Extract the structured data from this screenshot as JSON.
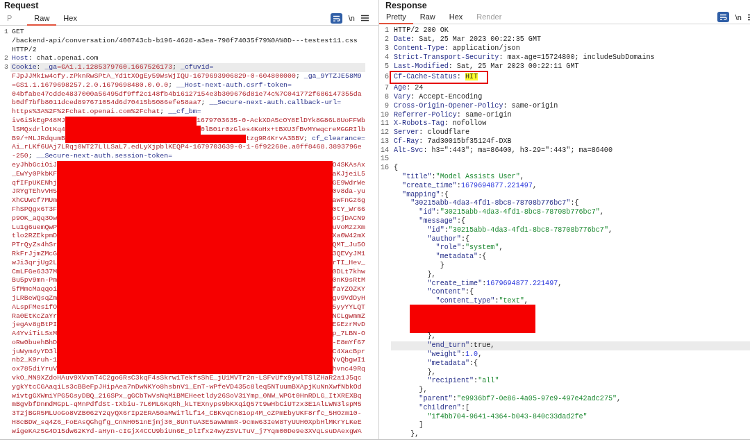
{
  "request": {
    "title": "Request",
    "newline_label": "\\n",
    "tabs": [
      {
        "label": "P",
        "selected": false,
        "disabled": true
      },
      {
        "label": "Raw",
        "selected": true,
        "disabled": false
      },
      {
        "label": "Hex",
        "selected": false,
        "disabled": false
      }
    ],
    "lines": [
      {
        "number": "1",
        "highlighted": false,
        "redacted": false,
        "segments": [
          {
            "kind": "plain",
            "text": "GET"
          }
        ]
      },
      {
        "highlighted": false,
        "redacted": false,
        "segments": [
          {
            "kind": "plain",
            "text": "/backend-api/conversation/400743cb-b196-4628-a3ea-798f74035f79%0A%0D---testest11.css"
          }
        ]
      },
      {
        "highlighted": false,
        "redacted": false,
        "segments": [
          {
            "kind": "plain",
            "text": "HTTP/2"
          }
        ]
      },
      {
        "number": "2",
        "highlighted": false,
        "redacted": false,
        "segments": [
          {
            "kind": "name",
            "text": "Host"
          },
          {
            "kind": "plain",
            "text": ": chat.openai.com"
          }
        ]
      },
      {
        "number": "3",
        "highlighted": true,
        "redacted": false,
        "segments": [
          {
            "kind": "name",
            "text": "Cookie"
          },
          {
            "kind": "plain",
            "text": ": "
          },
          {
            "kind": "name",
            "text": "_ga"
          },
          {
            "kind": "value",
            "text": "=GA1.1.1285379760.1667526173"
          },
          {
            "kind": "plain",
            "text": "; "
          },
          {
            "kind": "name",
            "text": "_cfuvid="
          }
        ]
      },
      {
        "highlighted": false,
        "redacted": false,
        "segments": [
          {
            "kind": "value",
            "text": "FJpJJMkiw4cfy.zPknRwSPtA_Yd1tXOgEy59WsWjIQU-1679693906829-0-604800000"
          },
          {
            "kind": "plain",
            "text": "; "
          },
          {
            "kind": "name",
            "text": "_ga_9YTZJE58M9"
          }
        ]
      },
      {
        "highlighted": false,
        "redacted": false,
        "segments": [
          {
            "kind": "value",
            "text": "=GS1.1.1679698257.2.0.1679698480.0.0.0"
          },
          {
            "kind": "plain",
            "text": "; "
          },
          {
            "kind": "name",
            "text": "__Host-next-auth.csrf-token="
          }
        ]
      },
      {
        "highlighted": false,
        "redacted": false,
        "segments": [
          {
            "kind": "value",
            "text": "04bfabe47cdde4837000a56495df9ff2c148fb4b16127154e3b309676d81e74c%7C041772f686147355da"
          }
        ]
      },
      {
        "highlighted": false,
        "redacted": false,
        "segments": [
          {
            "kind": "value",
            "text": "b0df7bfb8011dced897671054d6d70415b5086efe58aa7"
          },
          {
            "kind": "plain",
            "text": "; "
          },
          {
            "kind": "name",
            "text": "__Secure-next-auth.callback-url="
          }
        ]
      },
      {
        "highlighted": false,
        "redacted": false,
        "segments": [
          {
            "kind": "value",
            "text": "https%3A%2F%2Fchat.openai.com%2Fchat"
          },
          {
            "kind": "plain",
            "text": "; "
          },
          {
            "kind": "name",
            "text": "__cf_bm="
          }
        ]
      },
      {
        "highlighted": false,
        "redacted": true,
        "segments": [
          {
            "kind": "value",
            "text": "iv6iSkEgP48MJ"
          }
        ],
        "tail": [
          {
            "kind": "value",
            "text": "1679703635-0-AckXDA5cOY8ElDYk8G86L8UoFFWb"
          }
        ]
      },
      {
        "highlighted": false,
        "redacted": true,
        "segments": [
          {
            "kind": "value",
            "text": "lSMQxdrlOtKq4"
          }
        ],
        "tail": [
          {
            "kind": "value",
            "text": "0lB01r0zGles4KoHx+tBXU3fBvMYwqcreMGGRIlb"
          }
        ]
      },
      {
        "highlighted": false,
        "redacted": true,
        "segments": [
          {
            "kind": "value",
            "text": "B9/+MLJRdqumB"
          }
        ],
        "tail": [
          {
            "kind": "value",
            "text": "tzg9R4KrvA3BBV"
          },
          {
            "kind": "plain",
            "text": "; "
          },
          {
            "kind": "name",
            "text": "cf_clearance="
          }
        ]
      },
      {
        "highlighted": false,
        "redacted": false,
        "segments": [
          {
            "kind": "value",
            "text": "Ai_rLKf6UAj7LRqj0WT27LlLSaL7.edLyXjpblKEQP4-1679703639-0-1-6f92268e.a0ff8468.3893796e"
          }
        ]
      },
      {
        "highlighted": false,
        "redacted": false,
        "segments": [
          {
            "kind": "value",
            "text": "-250"
          },
          {
            "kind": "plain",
            "text": "; "
          },
          {
            "kind": "name",
            "text": "__Secure-next-auth.session-token="
          }
        ]
      },
      {
        "highlighted": false,
        "redacted": true,
        "segments": [
          {
            "kind": "value",
            "text": "eyJhbGciOiJ"
          }
        ],
        "tail": [
          {
            "kind": "value",
            "text": "O4SKAsAx"
          }
        ]
      },
      {
        "highlighted": false,
        "redacted": true,
        "segments": [
          {
            "kind": "value",
            "text": "_EwYy0PkbKF"
          }
        ],
        "tail": [
          {
            "kind": "value",
            "text": "aKJjeiL5"
          }
        ]
      },
      {
        "highlighted": false,
        "redacted": true,
        "segments": [
          {
            "kind": "value",
            "text": "qfIFpUKENhj"
          }
        ],
        "tail": [
          {
            "kind": "value",
            "text": "GE9WdrWe"
          }
        ]
      },
      {
        "highlighted": false,
        "redacted": true,
        "segments": [
          {
            "kind": "value",
            "text": "JRYgTEhvVH5"
          }
        ],
        "tail": [
          {
            "kind": "value",
            "text": "0v8da-yu"
          }
        ]
      },
      {
        "highlighted": false,
        "redacted": true,
        "segments": [
          {
            "kind": "value",
            "text": "XhCUWcf7MUm"
          }
        ],
        "tail": [
          {
            "kind": "value",
            "text": "awFnGz6g"
          }
        ]
      },
      {
        "highlighted": false,
        "redacted": true,
        "segments": [
          {
            "kind": "value",
            "text": "FhSPQgx6T3F"
          }
        ],
        "tail": [
          {
            "kind": "value",
            "text": "0tY_Wr66"
          }
        ]
      },
      {
        "highlighted": false,
        "redacted": true,
        "segments": [
          {
            "kind": "value",
            "text": "p9OK_aQq3Ow"
          }
        ],
        "tail": [
          {
            "kind": "value",
            "text": "oCjDACN9"
          }
        ]
      },
      {
        "highlighted": false,
        "redacted": true,
        "segments": [
          {
            "kind": "value",
            "text": "Lu1g6uemQwP"
          }
        ],
        "tail": [
          {
            "kind": "value",
            "text": "uVoMzzXm"
          }
        ]
      },
      {
        "highlighted": false,
        "redacted": true,
        "segments": [
          {
            "kind": "value",
            "text": "tlo2RZEkpmD"
          }
        ],
        "tail": [
          {
            "kind": "value",
            "text": "Xa0W42mX"
          }
        ]
      },
      {
        "highlighted": false,
        "redacted": true,
        "segments": [
          {
            "kind": "value",
            "text": "PTrQyZs4hSr"
          }
        ],
        "tail": [
          {
            "kind": "value",
            "text": "QMT_Ju5O"
          }
        ]
      },
      {
        "highlighted": false,
        "redacted": true,
        "segments": [
          {
            "kind": "value",
            "text": "RkFrJjmZMcG"
          }
        ],
        "tail": [
          {
            "kind": "value",
            "text": "3QEVyJM1"
          }
        ]
      },
      {
        "highlighted": false,
        "redacted": true,
        "segments": [
          {
            "kind": "value",
            "text": "wJi3qrjUg2L"
          }
        ],
        "tail": [
          {
            "kind": "value",
            "text": "rTI_Hev_"
          }
        ]
      },
      {
        "highlighted": false,
        "redacted": true,
        "segments": [
          {
            "kind": "value",
            "text": "CmLFGe6337M"
          }
        ],
        "tail": [
          {
            "kind": "value",
            "text": "0DLt7khw"
          }
        ]
      },
      {
        "highlighted": false,
        "redacted": true,
        "segments": [
          {
            "kind": "value",
            "text": "Bu5pv9mn-Pm"
          }
        ],
        "tail": [
          {
            "kind": "value",
            "text": "0nK9sRtM"
          }
        ]
      },
      {
        "highlighted": false,
        "redacted": true,
        "segments": [
          {
            "kind": "value",
            "text": "5fMmcMaqqoi"
          }
        ],
        "tail": [
          {
            "kind": "value",
            "text": "faYZOZKY"
          }
        ]
      },
      {
        "highlighted": false,
        "redacted": true,
        "segments": [
          {
            "kind": "value",
            "text": "jLRBeWQsqZm"
          }
        ],
        "tail": [
          {
            "kind": "value",
            "text": "gv9VdDyH"
          }
        ]
      },
      {
        "highlighted": false,
        "redacted": true,
        "segments": [
          {
            "kind": "value",
            "text": "ALspFMesifO"
          }
        ],
        "tail": [
          {
            "kind": "value",
            "text": "5yyYYLQT"
          }
        ]
      },
      {
        "highlighted": false,
        "redacted": true,
        "segments": [
          {
            "kind": "value",
            "text": "Ra0EtKcZaYr"
          }
        ],
        "tail": [
          {
            "kind": "value",
            "text": "NCLgwmmZ"
          }
        ]
      },
      {
        "highlighted": false,
        "redacted": true,
        "segments": [
          {
            "kind": "value",
            "text": "jegAv8gBtPI"
          }
        ],
        "tail": [
          {
            "kind": "value",
            "text": "EGEzrMvD"
          }
        ]
      },
      {
        "highlighted": false,
        "redacted": true,
        "segments": [
          {
            "kind": "value",
            "text": "A4YviTiLSxM"
          }
        ],
        "tail": [
          {
            "kind": "value",
            "text": "p_7LBN-O"
          }
        ]
      },
      {
        "highlighted": false,
        "redacted": true,
        "segments": [
          {
            "kind": "value",
            "text": "oRw0buehBhD"
          }
        ],
        "tail": [
          {
            "kind": "value",
            "text": "-E8mYf67"
          }
        ]
      },
      {
        "highlighted": false,
        "redacted": true,
        "segments": [
          {
            "kind": "value",
            "text": "juWym4yYD3l"
          }
        ],
        "tail": [
          {
            "kind": "value",
            "text": "C4XacBpr"
          }
        ]
      },
      {
        "highlighted": false,
        "redacted": true,
        "segments": [
          {
            "kind": "value",
            "text": "nb2_K9ruh-1"
          }
        ],
        "tail": [
          {
            "kind": "value",
            "text": "YvQbgwI1"
          }
        ]
      },
      {
        "highlighted": false,
        "redacted": true,
        "segments": [
          {
            "kind": "value",
            "text": "ox785diYruV"
          }
        ],
        "tail": [
          {
            "kind": "value",
            "text": "hvnc49Rq"
          }
        ]
      },
      {
        "highlighted": false,
        "redacted": false,
        "segments": [
          {
            "kind": "value",
            "text": "vkO_MN9XZdoHAuv9XVxnT4C2go6RsC3kqF4sSkrw1TekfsShE_jU1MVTr2n-LSFvUfx9ywlTSlZHaR2a1J5qc"
          }
        ]
      },
      {
        "highlighted": false,
        "redacted": false,
        "segments": [
          {
            "kind": "value",
            "text": "ygkYtcCGAaqiLs3cBBeFpJHipAea7nDwNKYo8hsbnV1_EnT-wPfeVD435c8leq5NTuumBXApjKuNnXwfNbkOd"
          }
        ]
      },
      {
        "highlighted": false,
        "redacted": false,
        "segments": [
          {
            "kind": "value",
            "text": "wivtgGXWmiYPG5GsyDBQ_216SPx_gGCbTwVsNqMiBMEHeetldy26SoV31Ymp_0NW_WPGt0HnRDLG_ItXREXBq"
          }
        ]
      },
      {
        "highlighted": false,
        "redacted": false,
        "segments": [
          {
            "kind": "value",
            "text": "mBgvbfDnmdMGpL-qMnPdfdSt-tXbiu-7L0ML6KqRh_kLTEXnyps9bKXqiQ57t9wHbCiUTzx3E1AlLWN3lspM5"
          }
        ]
      },
      {
        "highlighted": false,
        "redacted": false,
        "segments": [
          {
            "kind": "value",
            "text": "3T2jBGR5MLUoGo8VZB062Y2qyQX6rIp2ERA50aMWiTlLf14_CBKvqCn81op4M_cZPmEbyUKF8rfc_5HOzm10-"
          }
        ]
      },
      {
        "highlighted": false,
        "redacted": false,
        "segments": [
          {
            "kind": "value",
            "text": "H8cBDW_sq4Z6_FoEAsQGhgfg_CnNH051nEjmj30_8UnTuA3E5awWmmR-9cmw63IeW8TyUUH0XpbHlMKrYLKeE"
          }
        ]
      },
      {
        "highlighted": false,
        "redacted": false,
        "segments": [
          {
            "kind": "value",
            "text": "wigeKAz5G4D15dw62KYd-aHyn-cIGjX4CCU9biUn6E_DlIfx24wyZSVLTuV_j7Yqm00De9e3XVqLsuDAexgWA"
          }
        ]
      }
    ]
  },
  "response": {
    "title": "Response",
    "newline_label": "\\n",
    "tabs": [
      {
        "label": "Pretty",
        "selected": true,
        "disabled": false
      },
      {
        "label": "Raw",
        "selected": false,
        "disabled": false
      },
      {
        "label": "Hex",
        "selected": false,
        "disabled": false
      },
      {
        "label": "Render",
        "selected": false,
        "disabled": true
      }
    ],
    "headers": [
      {
        "number": "1",
        "boxed": false,
        "segments": [
          {
            "kind": "plain",
            "text": "HTTP/2 200 OK"
          }
        ]
      },
      {
        "number": "2",
        "boxed": false,
        "segments": [
          {
            "kind": "name",
            "text": "Date"
          },
          {
            "kind": "plain",
            "text": ": Sat, 25 Mar 2023 00:22:35 GMT"
          }
        ]
      },
      {
        "number": "3",
        "boxed": false,
        "segments": [
          {
            "kind": "name",
            "text": "Content-Type"
          },
          {
            "kind": "plain",
            "text": ": application/json"
          }
        ]
      },
      {
        "number": "4",
        "boxed": false,
        "segments": [
          {
            "kind": "name",
            "text": "Strict-Transport-Security"
          },
          {
            "kind": "plain",
            "text": ": max-age=15724800; includeSubDomains"
          }
        ]
      },
      {
        "number": "5",
        "boxed": false,
        "segments": [
          {
            "kind": "name",
            "text": "Last-Modified"
          },
          {
            "kind": "plain",
            "text": ": Sat, 25 Mar 2023 00:22:11 GMT"
          }
        ]
      },
      {
        "number": "6",
        "boxed": true,
        "segments": [
          {
            "kind": "name",
            "text": "Cf-Cache-Status"
          },
          {
            "kind": "plain",
            "text": ": "
          },
          {
            "kind": "mark",
            "text": "HIT"
          }
        ]
      },
      {
        "number": "7",
        "boxed": false,
        "segments": [
          {
            "kind": "name",
            "text": "Age"
          },
          {
            "kind": "plain",
            "text": ": 24"
          }
        ]
      },
      {
        "number": "8",
        "boxed": false,
        "segments": [
          {
            "kind": "name",
            "text": "Vary"
          },
          {
            "kind": "plain",
            "text": ": Accept-Encoding"
          }
        ]
      },
      {
        "number": "9",
        "boxed": false,
        "segments": [
          {
            "kind": "name",
            "text": "Cross-Origin-Opener-Policy"
          },
          {
            "kind": "plain",
            "text": ": same-origin"
          }
        ]
      },
      {
        "number": "10",
        "boxed": false,
        "segments": [
          {
            "kind": "name",
            "text": "Referrer-Policy"
          },
          {
            "kind": "plain",
            "text": ": same-origin"
          }
        ]
      },
      {
        "number": "11",
        "boxed": false,
        "segments": [
          {
            "kind": "name",
            "text": "X-Robots-Tag"
          },
          {
            "kind": "plain",
            "text": ": nofollow"
          }
        ]
      },
      {
        "number": "12",
        "boxed": false,
        "segments": [
          {
            "kind": "name",
            "text": "Server"
          },
          {
            "kind": "plain",
            "text": ": cloudflare"
          }
        ]
      },
      {
        "number": "13",
        "boxed": false,
        "segments": [
          {
            "kind": "name",
            "text": "Cf-Ray"
          },
          {
            "kind": "plain",
            "text": ": 7ad30015bf35124f-DXB"
          }
        ]
      },
      {
        "number": "14",
        "boxed": false,
        "segments": [
          {
            "kind": "name",
            "text": "Alt-Svc"
          },
          {
            "kind": "plain",
            "text": ": h3=\":443\"; ma=86400, h3-29=\":443\"; ma=86400"
          }
        ]
      },
      {
        "number": "15",
        "boxed": false
      }
    ],
    "body": [
      {
        "kind": "code",
        "number": "16",
        "highlighted": false,
        "segments": [
          {
            "kind": "plain",
            "text": "{"
          }
        ],
        "children": [
          {
            "kind": "code",
            "highlighted": false,
            "segments": [
              {
                "kind": "name",
                "text": "\"title\""
              },
              {
                "kind": "plain",
                "text": ":"
              },
              {
                "kind": "string",
                "text": "\"Model Assists User\""
              },
              {
                "kind": "plain",
                "text": ","
              }
            ]
          },
          {
            "kind": "code",
            "highlighted": false,
            "segments": [
              {
                "kind": "name",
                "text": "\"create_time\""
              },
              {
                "kind": "plain",
                "text": ":"
              },
              {
                "kind": "number",
                "text": "1679694877.221497"
              },
              {
                "kind": "plain",
                "text": ","
              }
            ]
          },
          {
            "kind": "code",
            "highlighted": false,
            "segments": [
              {
                "kind": "name",
                "text": "\"mapping\""
              },
              {
                "kind": "plain",
                "text": ":{"
              }
            ],
            "children": [
              {
                "kind": "code",
                "highlighted": false,
                "segments": [
                  {
                    "kind": "name",
                    "text": "\"30215abb-4da3-4fd1-8bc8-78708b776bc7\""
                  },
                  {
                    "kind": "plain",
                    "text": ":{"
                  }
                ],
                "children": [
                  {
                    "kind": "code",
                    "highlighted": false,
                    "segments": [
                      {
                        "kind": "name",
                        "text": "\"id\""
                      },
                      {
                        "kind": "plain",
                        "text": ":"
                      },
                      {
                        "kind": "string",
                        "text": "\"30215abb-4da3-4fd1-8bc8-78708b776bc7\""
                      },
                      {
                        "kind": "plain",
                        "text": ","
                      }
                    ]
                  },
                  {
                    "kind": "code",
                    "highlighted": false,
                    "segments": [
                      {
                        "kind": "name",
                        "text": "\"message\""
                      },
                      {
                        "kind": "plain",
                        "text": ":{"
                      }
                    ],
                    "children": [
                      {
                        "kind": "code",
                        "highlighted": false,
                        "segments": [
                          {
                            "kind": "name",
                            "text": "\"id\""
                          },
                          {
                            "kind": "plain",
                            "text": ":"
                          },
                          {
                            "kind": "string",
                            "text": "\"30215abb-4da3-4fd1-8bc8-78708b776bc7\""
                          },
                          {
                            "kind": "plain",
                            "text": ","
                          }
                        ]
                      },
                      {
                        "kind": "code",
                        "highlighted": false,
                        "segments": [
                          {
                            "kind": "name",
                            "text": "\"author\""
                          },
                          {
                            "kind": "plain",
                            "text": ":{"
                          }
                        ],
                        "children": [
                          {
                            "kind": "code",
                            "highlighted": false,
                            "segments": [
                              {
                                "kind": "name",
                                "text": "\"role\""
                              },
                              {
                                "kind": "plain",
                                "text": ":"
                              },
                              {
                                "kind": "string",
                                "text": "\"system\""
                              },
                              {
                                "kind": "plain",
                                "text": ","
                              }
                            ]
                          },
                          {
                            "kind": "code",
                            "highlighted": false,
                            "segments": [
                              {
                                "kind": "name",
                                "text": "\"metadata\""
                              },
                              {
                                "kind": "plain",
                                "text": ":{"
                              }
                            ]
                          },
                          {
                            "kind": "code",
                            "highlighted": false,
                            "segments": [
                              {
                                "kind": "plain",
                                "text": " }"
                              }
                            ]
                          }
                        ]
                      },
                      {
                        "kind": "code",
                        "highlighted": false,
                        "segments": [
                          {
                            "kind": "plain",
                            "text": "},"
                          }
                        ]
                      },
                      {
                        "kind": "code",
                        "highlighted": false,
                        "segments": [
                          {
                            "kind": "name",
                            "text": "\"create_time\""
                          },
                          {
                            "kind": "plain",
                            "text": ":"
                          },
                          {
                            "kind": "number",
                            "text": "1679694877.221497"
                          },
                          {
                            "kind": "plain",
                            "text": ","
                          }
                        ]
                      },
                      {
                        "kind": "code",
                        "highlighted": false,
                        "segments": [
                          {
                            "kind": "name",
                            "text": "\"content\""
                          },
                          {
                            "kind": "plain",
                            "text": ":{"
                          }
                        ],
                        "children": [
                          {
                            "kind": "code",
                            "highlighted": false,
                            "segments": [
                              {
                                "kind": "name",
                                "text": "\"content_type\""
                              },
                              {
                                "kind": "plain",
                                "text": ":"
                              },
                              {
                                "kind": "string",
                                "text": "\"text\""
                              },
                              {
                                "kind": "plain",
                                "text": ","
                              }
                            ]
                          },
                          {
                            "kind": "redaction"
                          }
                        ]
                      },
                      {
                        "kind": "code",
                        "highlighted": false,
                        "segments": [
                          {
                            "kind": "plain",
                            "text": "},"
                          }
                        ]
                      },
                      {
                        "kind": "code",
                        "highlighted": true,
                        "segments": [
                          {
                            "kind": "name",
                            "text": "\"end_turn\""
                          },
                          {
                            "kind": "plain",
                            "text": ":true,"
                          }
                        ]
                      },
                      {
                        "kind": "code",
                        "highlighted": false,
                        "segments": [
                          {
                            "kind": "name",
                            "text": "\"weight\""
                          },
                          {
                            "kind": "plain",
                            "text": ":"
                          },
                          {
                            "kind": "number",
                            "text": "1.0"
                          },
                          {
                            "kind": "plain",
                            "text": ","
                          }
                        ]
                      },
                      {
                        "kind": "code",
                        "highlighted": false,
                        "segments": [
                          {
                            "kind": "name",
                            "text": "\"metadata\""
                          },
                          {
                            "kind": "plain",
                            "text": ":{"
                          }
                        ]
                      },
                      {
                        "kind": "code",
                        "highlighted": false,
                        "segments": [
                          {
                            "kind": "plain",
                            "text": "},"
                          }
                        ]
                      },
                      {
                        "kind": "code",
                        "highlighted": false,
                        "segments": [
                          {
                            "kind": "name",
                            "text": "\"recipient\""
                          },
                          {
                            "kind": "plain",
                            "text": ":"
                          },
                          {
                            "kind": "string",
                            "text": "\"all\""
                          }
                        ]
                      }
                    ]
                  },
                  {
                    "kind": "code",
                    "highlighted": false,
                    "segments": [
                      {
                        "kind": "plain",
                        "text": "},"
                      }
                    ]
                  },
                  {
                    "kind": "code",
                    "highlighted": false,
                    "segments": [
                      {
                        "kind": "name",
                        "text": "\"parent\""
                      },
                      {
                        "kind": "plain",
                        "text": ":"
                      },
                      {
                        "kind": "string",
                        "text": "\"e9936bf7-0e86-4a05-97e9-497e42adc275\""
                      },
                      {
                        "kind": "plain",
                        "text": ","
                      }
                    ]
                  },
                  {
                    "kind": "code",
                    "highlighted": false,
                    "segments": [
                      {
                        "kind": "name",
                        "text": "\"children\""
                      },
                      {
                        "kind": "plain",
                        "text": ":["
                      }
                    ],
                    "children": [
                      {
                        "kind": "code",
                        "highlighted": false,
                        "segments": [
                          {
                            "kind": "string",
                            "text": "\"1f4bb704-9641-4364-b043-840c33dad2fe\""
                          }
                        ]
                      }
                    ]
                  },
                  {
                    "kind": "code",
                    "highlighted": false,
                    "segments": [
                      {
                        "kind": "plain",
                        "text": "]"
                      }
                    ]
                  }
                ]
              },
              {
                "kind": "code",
                "highlighted": false,
                "segments": [
                  {
                    "kind": "plain",
                    "text": "},"
                  }
                ]
              }
            ]
          }
        ]
      }
    ]
  }
}
